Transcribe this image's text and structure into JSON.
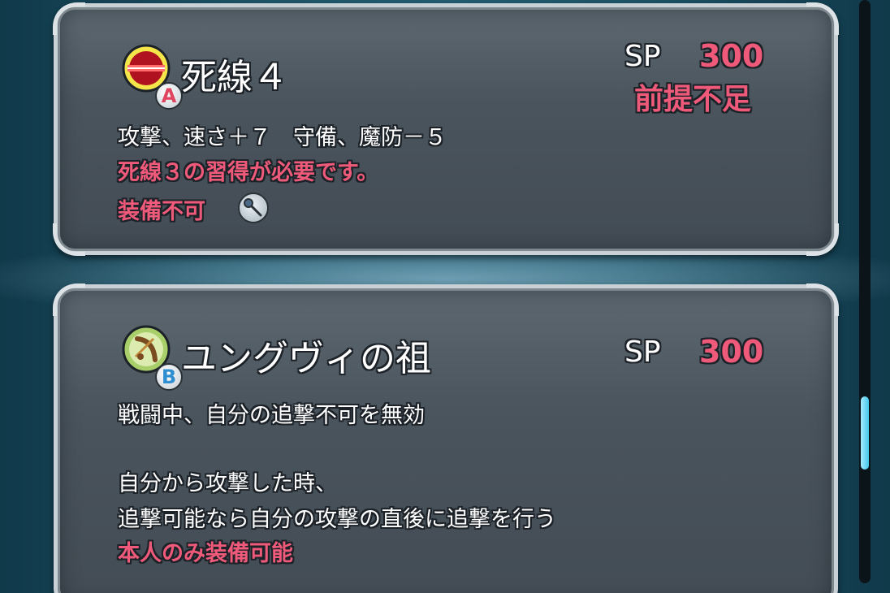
{
  "skills": [
    {
      "name": "死線４",
      "slot": "A",
      "icon": "red-stripe-skill-icon",
      "sp_label": "SP",
      "sp_value": "300",
      "status": "前提不足",
      "effect": "攻撃、速さ＋７　守備、魔防－５",
      "requirement": "死線３の習得が必要です。",
      "equip_note": "装備不可",
      "equip_icon": "staff-weapon-icon"
    },
    {
      "name": "ユングヴィの祖",
      "slot": "B",
      "icon": "bow-skill-icon",
      "sp_label": "SP",
      "sp_value": "300",
      "effect_lines": [
        "戦闘中、自分の追撃不可を無効",
        "",
        "自分から攻撃した時、",
        "追撃可能なら自分の攻撃の直後に追撃を行う"
      ],
      "restriction": "本人のみ装備可能"
    }
  ],
  "colors": {
    "accent_red": "#f05a7a",
    "text_white": "#ffffff",
    "slot_a": "#e0455f",
    "slot_b": "#2f8fd0",
    "scrollbar": "#45c6ea"
  }
}
